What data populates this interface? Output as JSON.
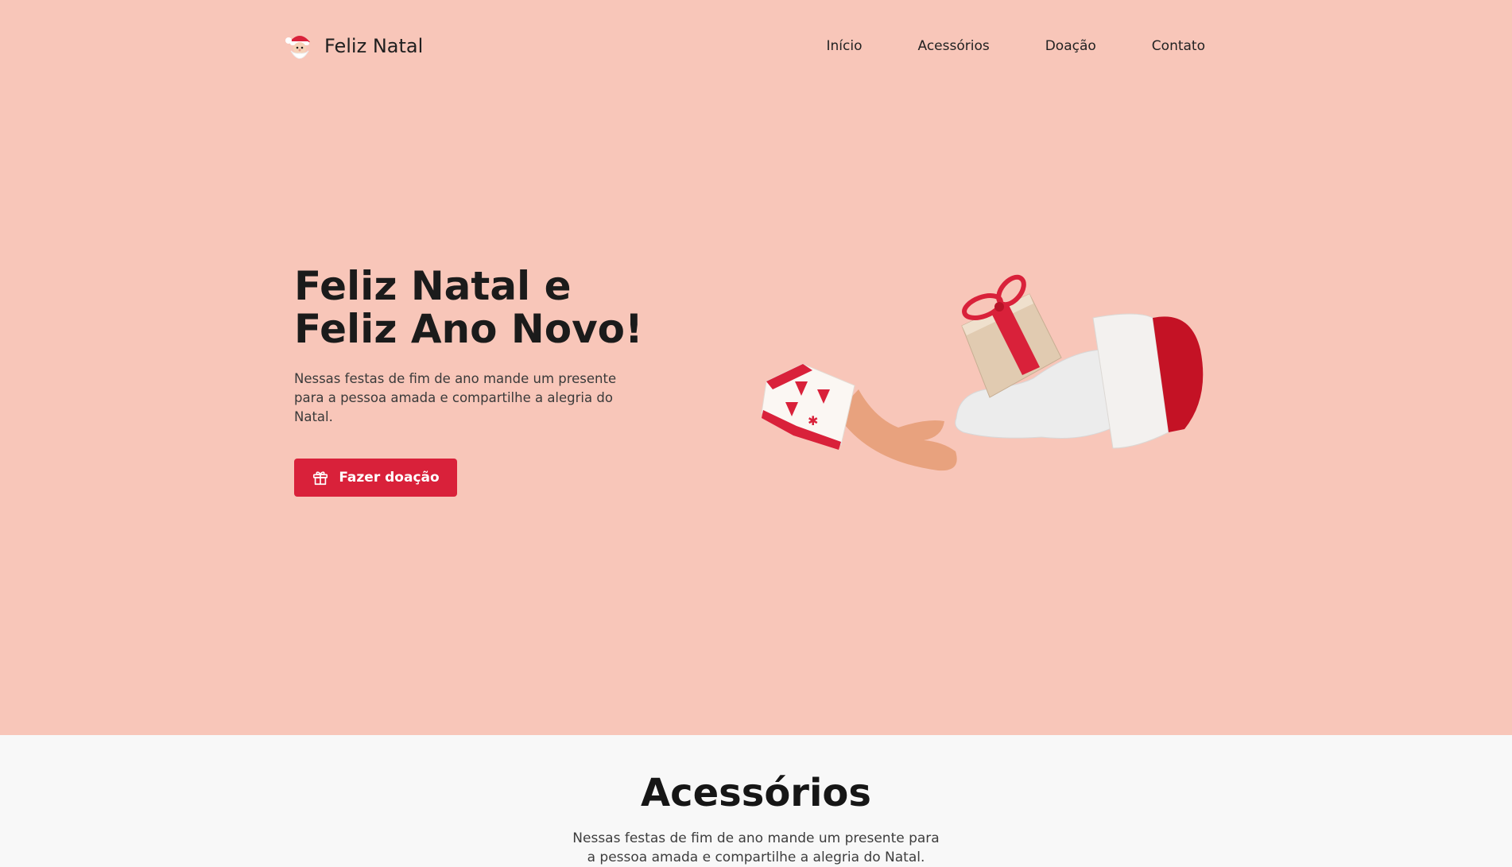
{
  "brand": {
    "name": "Feliz Natal",
    "icon": "santa-icon"
  },
  "nav": {
    "items": [
      {
        "label": "Início"
      },
      {
        "label": "Acessórios"
      },
      {
        "label": "Doação"
      },
      {
        "label": "Contato"
      }
    ]
  },
  "hero": {
    "title": "Feliz Natal e Feliz Ano Novo!",
    "description": "Nessas festas de fim de ano mande um presente para a pessoa amada e compartilhe a alegria do Natal.",
    "cta_label": "Fazer doação",
    "cta_icon": "gift-icon",
    "illustration": "hands-exchanging-gift"
  },
  "accessories": {
    "title": "Acessórios",
    "description": "Nessas festas de fim de ano mande um presente para a pessoa amada e compartilhe a alegria do Natal."
  },
  "colors": {
    "hero_background": "#f8c6b9",
    "accent": "#d9213a",
    "section_background": "#f8f8f8"
  }
}
